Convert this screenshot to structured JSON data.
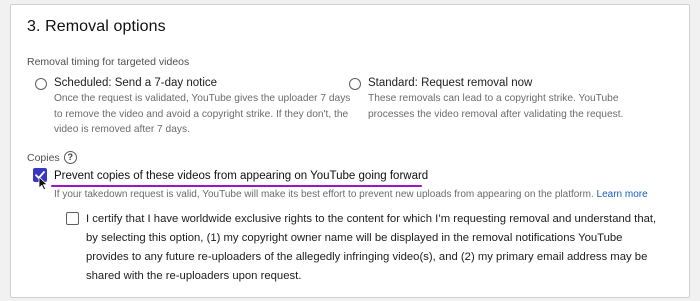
{
  "section": {
    "title": "3. Removal options",
    "timing_label": "Removal timing for targeted videos"
  },
  "timing_options": [
    {
      "title": "Scheduled: Send a 7-day notice",
      "description_lines": [
        "Once the request is validated, YouTube gives the uploader 7 days",
        "to remove the video and avoid a copyright strike. If they don't, the",
        "video is removed after 7 days."
      ],
      "selected": false
    },
    {
      "title": "Standard: Request removal now",
      "description_lines": [
        "These removals can lead to a copyright strike. YouTube",
        "processes the video removal after validating the request."
      ],
      "selected": false
    }
  ],
  "copies": {
    "label": "Copies",
    "help_icon": "question-circle-icon",
    "prevent_option": {
      "label": "Prevent copies of these videos from appearing on YouTube going forward",
      "checked": true,
      "description": "If your takedown request is valid, YouTube will make its best effort to prevent new uploads from appearing on the platform.",
      "learn_more": "Learn more"
    },
    "certify_option": {
      "checked": false,
      "lines": [
        "I certify that I have worldwide exclusive rights to the content for which I’m requesting removal and understand that,",
        "by selecting this option, (1) my copyright owner name will be displayed in the removal notifications YouTube",
        "provides to any future re-uploaders of the allegedly infringing video(s), and (2) my primary email address may be",
        "shared with the re-uploaders upon request."
      ]
    }
  },
  "colors": {
    "checkbox_accent": "#3b35c4",
    "annotation_underline": "#9b16c8",
    "link": "#1a5bbf"
  }
}
